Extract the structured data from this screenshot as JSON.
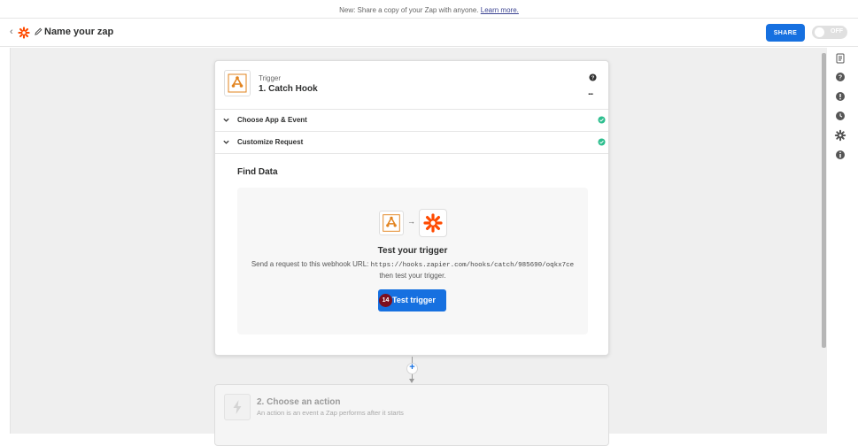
{
  "banner": {
    "text": "New: Share a copy of your Zap with anyone.",
    "link": "Learn more."
  },
  "header": {
    "zap_name": "Name your zap",
    "share_label": "SHARE",
    "toggle_label": "OFF"
  },
  "trigger_card": {
    "trigger_label": "Trigger",
    "step_title": "1. Catch Hook",
    "more_label": "...",
    "sections": [
      {
        "title": "Choose App & Event",
        "complete": true
      },
      {
        "title": "Customize Request",
        "complete": true
      }
    ],
    "find_data_title": "Find Data",
    "test_panel": {
      "title": "Test your trigger",
      "desc_prefix": "Send a request to this webhook URL:",
      "url": "https://hooks.zapier.com/hooks/catch/985690/oqkx7ce",
      "desc_suffix": "then test your trigger.",
      "button_label": "Test trigger",
      "badge": "14"
    }
  },
  "action_card": {
    "title": "2. Choose an action",
    "subtitle": "An action is an event a Zap performs after it starts"
  },
  "connector": {
    "add_label": "+"
  },
  "rail_icons": [
    "notes-icon",
    "help-icon",
    "alert-icon",
    "history-icon",
    "settings-icon",
    "info-icon"
  ],
  "colors": {
    "brand_orange": "#ff4a00",
    "primary_blue": "#1670e0",
    "success_green": "#2dbe8e",
    "badge_red": "#7d0f1f"
  }
}
